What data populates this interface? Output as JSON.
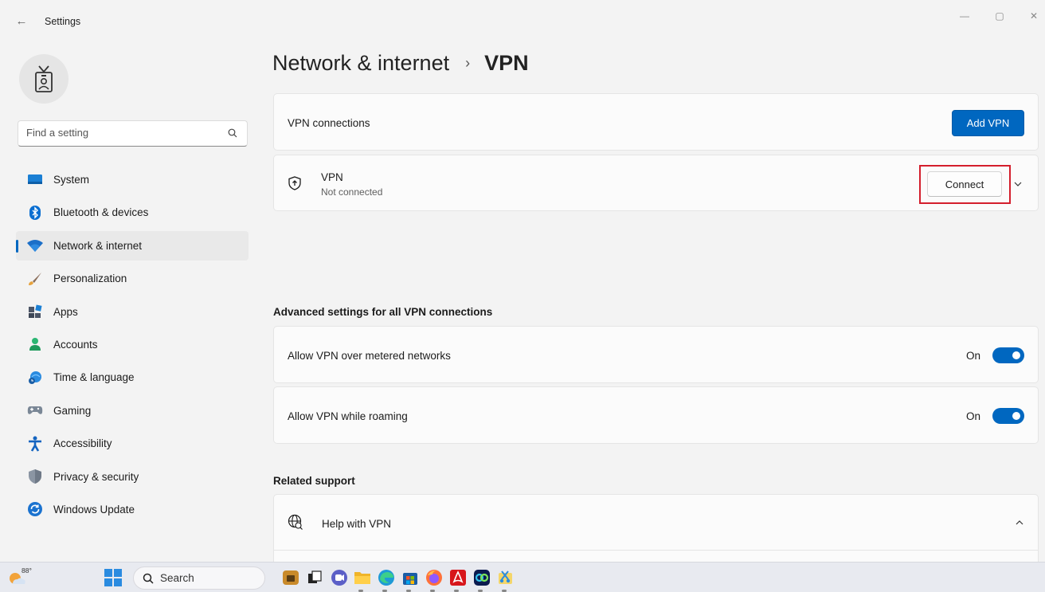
{
  "window": {
    "title": "Settings",
    "controls": {
      "minimize": "—",
      "maximize": "▢",
      "close": "✕"
    }
  },
  "sidebar": {
    "search_placeholder": "Find a setting",
    "items": [
      {
        "label": "System",
        "icon": "system-icon",
        "active": false
      },
      {
        "label": "Bluetooth & devices",
        "icon": "bluetooth-icon",
        "active": false
      },
      {
        "label": "Network & internet",
        "icon": "wifi-icon",
        "active": true
      },
      {
        "label": "Personalization",
        "icon": "brush-icon",
        "active": false
      },
      {
        "label": "Apps",
        "icon": "apps-icon",
        "active": false
      },
      {
        "label": "Accounts",
        "icon": "accounts-icon",
        "active": false
      },
      {
        "label": "Time & language",
        "icon": "globe-clock-icon",
        "active": false
      },
      {
        "label": "Gaming",
        "icon": "gamepad-icon",
        "active": false
      },
      {
        "label": "Accessibility",
        "icon": "accessibility-icon",
        "active": false
      },
      {
        "label": "Privacy & security",
        "icon": "shield-icon",
        "active": false
      },
      {
        "label": "Windows Update",
        "icon": "update-icon",
        "active": false
      }
    ]
  },
  "header": {
    "parent": "Network & internet",
    "separator": "›",
    "current": "VPN"
  },
  "vpn_connections": {
    "label": "VPN connections",
    "add_button": "Add VPN"
  },
  "vpn_entry": {
    "name": "VPN",
    "status": "Not connected",
    "connect_button": "Connect"
  },
  "advanced": {
    "title": "Advanced settings for all VPN connections",
    "settings": [
      {
        "label": "Allow VPN over metered networks",
        "state": "On"
      },
      {
        "label": "Allow VPN while roaming",
        "state": "On"
      }
    ]
  },
  "related": {
    "title": "Related support",
    "help_label": "Help with VPN"
  },
  "taskbar": {
    "weather_temp": "88°",
    "search_label": "Search"
  },
  "colors": {
    "accent": "#0067c0",
    "highlight": "#d41e2c"
  }
}
